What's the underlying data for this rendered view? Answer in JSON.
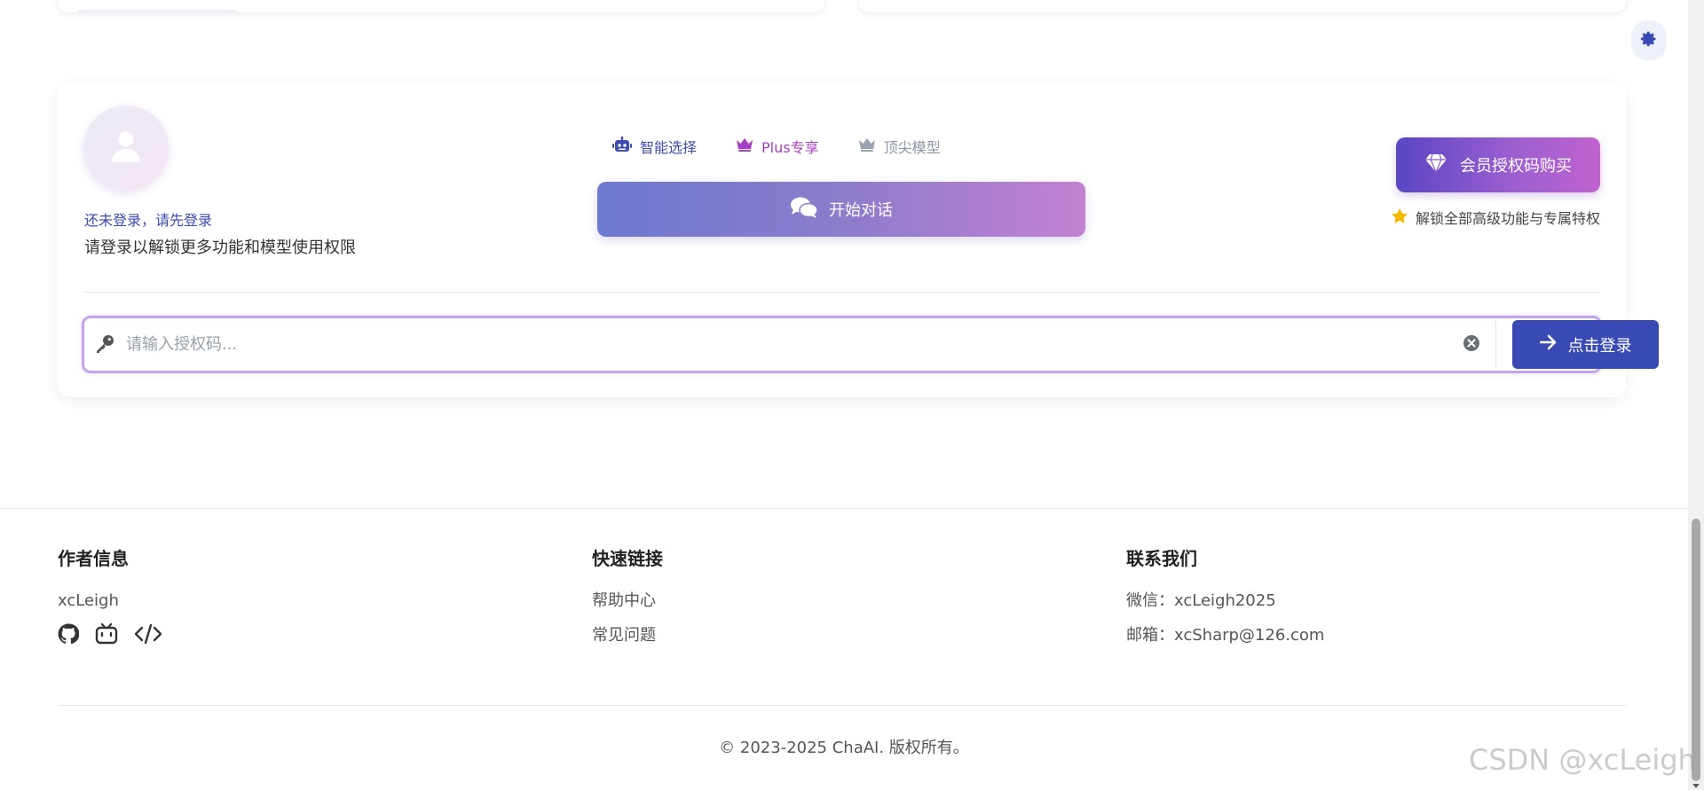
{
  "profile": {
    "login_prompt": "还未登录，请先登录",
    "login_description": "请登录以解锁更多功能和模型使用权限"
  },
  "model_tabs": [
    {
      "label": "智能选择",
      "icon": "robot-icon"
    },
    {
      "label": "Plus专享",
      "icon": "crown-icon"
    },
    {
      "label": "顶尖模型",
      "icon": "crown-icon"
    }
  ],
  "start_chat": {
    "label": "开始对话",
    "icon": "comments-icon"
  },
  "membership": {
    "buy_label": "会员授权码购买",
    "buy_icon": "gem-icon",
    "hint": "解锁全部高级功能与专属特权",
    "hint_icon": "star-icon"
  },
  "auth": {
    "placeholder": "请输入授权码...",
    "value": "",
    "submit_label": "点击登录",
    "key_icon": "key-icon",
    "clear_icon": "clear-icon",
    "submit_icon": "arrow-right-icon"
  },
  "footer": {
    "author": {
      "title": "作者信息",
      "name": "xcLeigh",
      "social_icons": [
        "github-icon",
        "bilibili-icon",
        "code-icon"
      ]
    },
    "links": {
      "title": "快速链接",
      "items": [
        "帮助中心",
        "常见问题"
      ]
    },
    "contact": {
      "title": "联系我们",
      "wechat": "微信：xcLeigh2025",
      "email": "邮箱：xcSharp@126.com"
    },
    "copyright": "© 2023-2025 ChaAI. 版权所有。"
  },
  "watermark": "CSDN @xcLeigh",
  "colors": {
    "accent": "#3a4ab5",
    "plus": "#a63fc4",
    "auth_border": "#c3a4ea",
    "star": "#f5b800"
  }
}
